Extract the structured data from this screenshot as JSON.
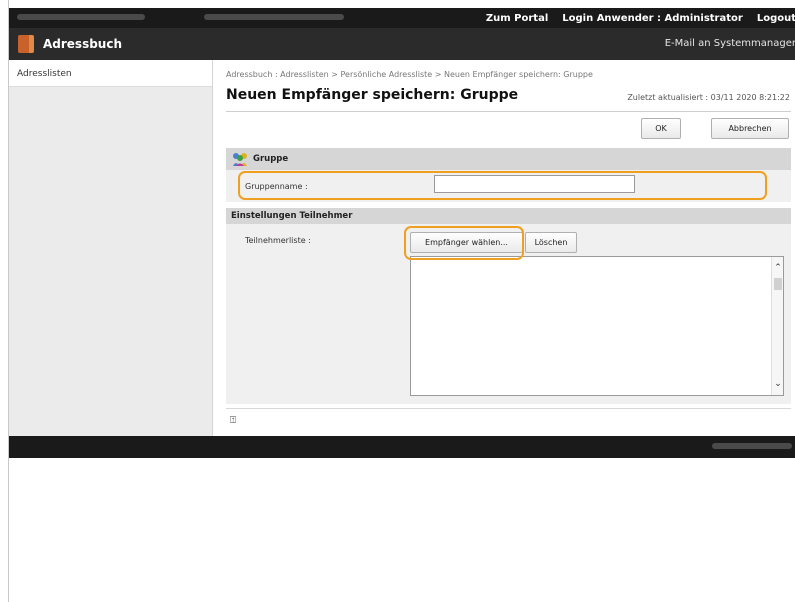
{
  "topbar": {
    "portal_link": "Zum Portal",
    "login_label": "Login Anwender :",
    "login_user": "Administrator",
    "logout_link": "Logout"
  },
  "appbar": {
    "title": "Adressbuch",
    "mail_link": "E-Mail an Systemmanager"
  },
  "sidebar": {
    "items": [
      {
        "label": "Adresslisten"
      }
    ]
  },
  "main": {
    "breadcrumb": "Adressbuch : Adresslisten > Persönliche Adressliste > Neuen Empfänger speichern: Gruppe",
    "page_title": "Neuen Empfänger speichern: Gruppe",
    "last_updated": "Zuletzt aktualisiert : 03/11 2020 8:21:22",
    "ok_label": "OK",
    "cancel_label": "Abbrechen",
    "group_section": {
      "title": "Gruppe",
      "name_label": "Gruppenname :",
      "name_value": ""
    },
    "members_section": {
      "title": "Einstellungen Teilnehmer",
      "list_label": "Teilnehmerliste :",
      "select_button": "Empfänger wählen...",
      "delete_button": "Löschen",
      "members": []
    },
    "to_top_glyph": "⍐"
  },
  "colors": {
    "highlight": "#f0a020",
    "topbar_bg": "#1a1a1a",
    "appbar_bg": "#2b2b2b",
    "section_head_bg": "#d6d6d6",
    "section_body_bg": "#f0f0f0"
  }
}
